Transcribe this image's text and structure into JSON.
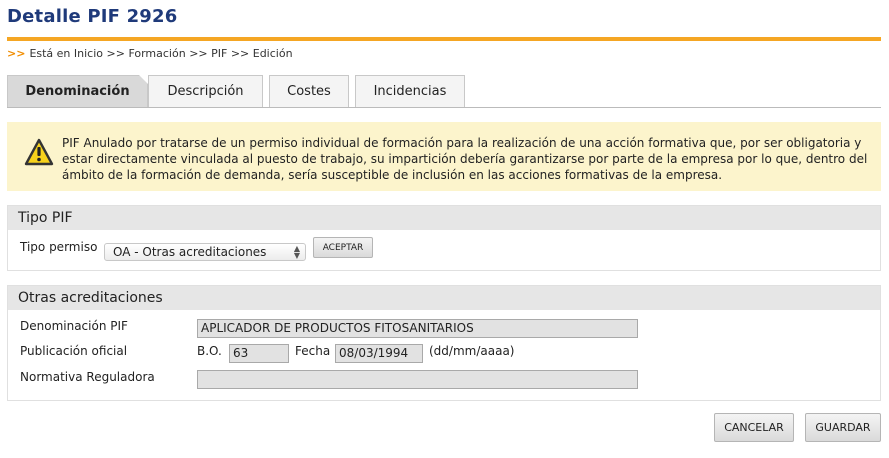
{
  "page": {
    "title": "Detalle PIF 2926"
  },
  "breadcrumb": {
    "arrow": ">>",
    "text": "Está en Inicio >> Formación >> PIF >> Edición"
  },
  "tabs": [
    {
      "label": "Denominación",
      "active": true
    },
    {
      "label": "Descripción",
      "active": false
    },
    {
      "label": "Costes",
      "active": false
    },
    {
      "label": "Incidencias",
      "active": false
    }
  ],
  "warning": {
    "icon": "warning-icon",
    "text": "PIF Anulado por tratarse de un permiso individual de formación para la realización de una acción formativa que, por ser obligatoria y estar directamente vinculada al puesto de trabajo, su impartición debería garantizarse por parte de la empresa por lo que, dentro del ámbito de la formación de demanda, sería susceptible de inclusión en las acciones formativas de la empresa."
  },
  "tipo_pif": {
    "heading": "Tipo PIF",
    "permiso_label": "Tipo permiso",
    "permiso_value": "OA - Otras acreditaciones",
    "accept_label": "ACEPTAR"
  },
  "otras": {
    "heading": "Otras acreditaciones",
    "denominacion_label": "Denominación PIF",
    "denominacion_value": "APLICADOR DE PRODUCTOS FITOSANITARIOS",
    "publicacion_label": "Publicación oficial",
    "bo_label": "B.O.",
    "bo_value": "63",
    "fecha_label": "Fecha",
    "fecha_value": "08/03/1994",
    "fecha_format": "(dd/mm/aaaa)",
    "normativa_label": "Normativa Reguladora",
    "normativa_value": ""
  },
  "actions": {
    "cancel_label": "CANCELAR",
    "save_label": "GUARDAR"
  },
  "colors": {
    "title": "#1f3a7a",
    "accent": "#f5a623",
    "warning_bg": "#fcf4cc"
  }
}
